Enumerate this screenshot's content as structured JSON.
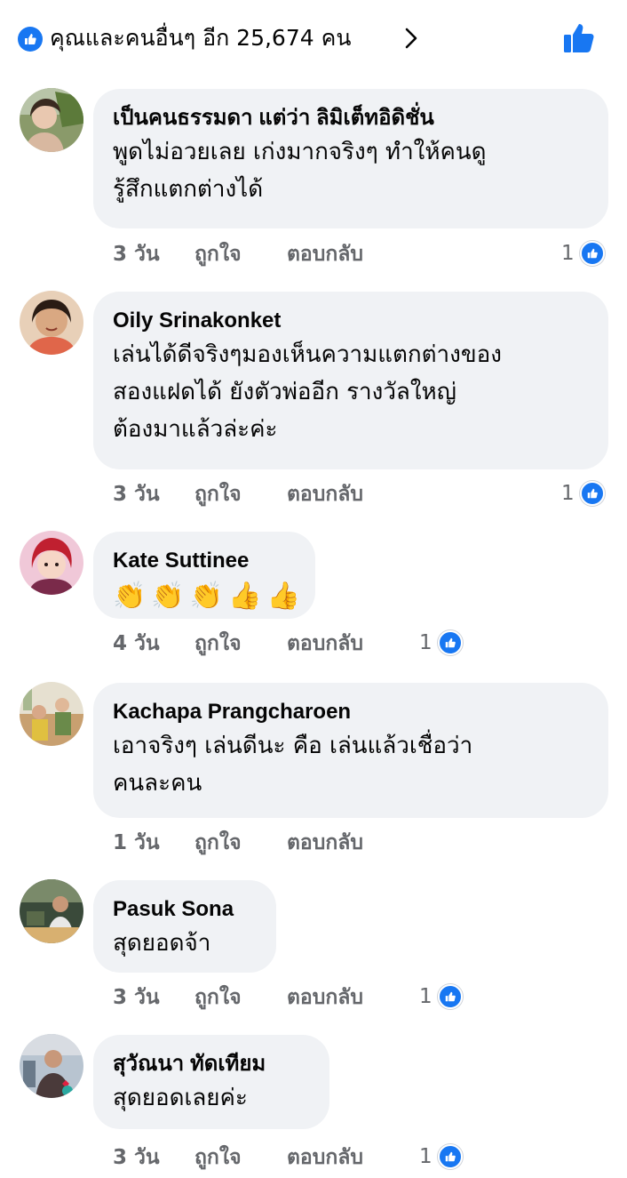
{
  "header": {
    "reactions_summary": "คุณและคนอื่นๆ อีก 25,674 คน",
    "chevron_icon": "chevron-right-icon",
    "thumb_icon": "like-thumb-icon",
    "accent": "#1877f2"
  },
  "comments": [
    {
      "author": "เป็นคนธรรมดา แต่ว่า ลิมิเต็ทอิดิชั่น",
      "lines": [
        "พูดไม่อวยเลย เก่งมากจริงๆ ทำให้คนดู",
        "รู้สึกแตกต่างได้"
      ],
      "time": "3 วัน",
      "like_label": "ถูกใจ",
      "reply_label": "ตอบกลับ",
      "reaction_count": "1"
    },
    {
      "author": "Oily Srinakonket",
      "lines": [
        "เล่นได้ดีจริงๆมองเห็นความแตกต่างของ",
        "สองแฝดได้ ยังตัวพ่ออีก รางวัลใหญ่",
        "ต้องมาแล้วล่ะค่ะ"
      ],
      "time": "3 วัน",
      "like_label": "ถูกใจ",
      "reply_label": "ตอบกลับ",
      "reaction_count": "1"
    },
    {
      "author": "Kate Suttinee",
      "emojis": [
        "👏",
        "👏",
        "👏",
        "👍",
        "👍"
      ],
      "time": "4 วัน",
      "like_label": "ถูกใจ",
      "reply_label": "ตอบกลับ",
      "reaction_count": "1"
    },
    {
      "author": "Kachapa Prangcharoen",
      "lines": [
        "เอาจริงๆ เล่นดีนะ คือ เล่นแล้วเชื่อว่า",
        "คนละคน"
      ],
      "time": "1 วัน",
      "like_label": "ถูกใจ",
      "reply_label": "ตอบกลับ",
      "reaction_count": ""
    },
    {
      "author": "Pasuk Sona",
      "lines": [
        "สุดยอดจ้า"
      ],
      "time": "3 วัน",
      "like_label": "ถูกใจ",
      "reply_label": "ตอบกลับ",
      "reaction_count": "1"
    },
    {
      "author": "สุวัณนา ทัดเทียม",
      "lines": [
        "สุดยอดเลยค่ะ"
      ],
      "time": "3 วัน",
      "like_label": "ถูกใจ",
      "reply_label": "ตอบกลับ",
      "reaction_count": "1"
    }
  ]
}
